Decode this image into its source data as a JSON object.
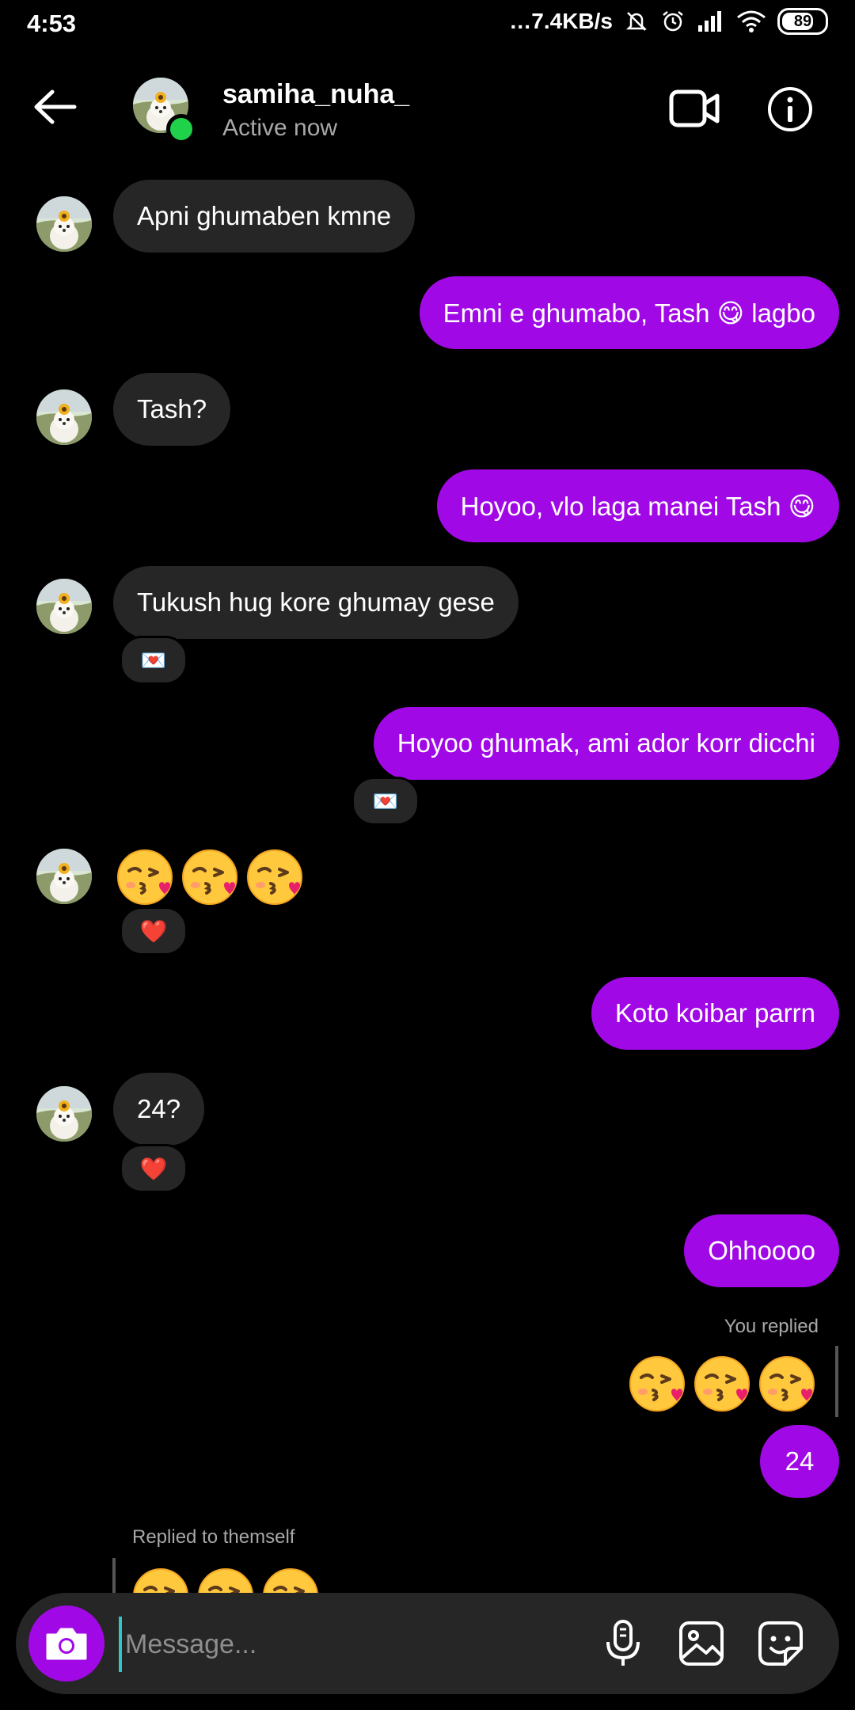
{
  "status_bar": {
    "time": "4:53",
    "net_speed": "…7.4KB/s",
    "battery": "89"
  },
  "header": {
    "username": "samiha_nuha_",
    "status": "Active now"
  },
  "messages": [
    {
      "side": "in",
      "text": "Apni ghumaben kmne"
    },
    {
      "side": "out",
      "text": "Emni e ghumabo, Tash 😋 lagbo"
    },
    {
      "side": "in",
      "text": "Tash?"
    },
    {
      "side": "out",
      "text": "Hoyoo, vlo laga manei Tash 😋"
    },
    {
      "side": "in",
      "text": "Tukush hug kore ghumay gese",
      "reaction": "💌"
    },
    {
      "side": "out",
      "text": "Hoyoo ghumak, ami ador korr dicchi",
      "reaction": "💌"
    },
    {
      "side": "in",
      "emoji": "😘😘😘",
      "reaction": "❤️"
    },
    {
      "side": "out",
      "text": "Koto koibar parrn"
    },
    {
      "side": "in",
      "text": "24?",
      "reaction": "❤️"
    },
    {
      "side": "out",
      "text": "Ohhoooo"
    },
    {
      "side": "out",
      "reply_label": "You replied",
      "emoji": "😘😘😘"
    },
    {
      "side": "out",
      "text": "24"
    },
    {
      "side": "in",
      "reply_label": "Replied to themself",
      "emoji": "😘😘😘"
    }
  ],
  "composer": {
    "placeholder": "Message..."
  },
  "icons": [
    "back-arrow-icon",
    "video-call-icon",
    "info-icon",
    "camera-icon",
    "microphone-icon",
    "gallery-icon",
    "sticker-icon"
  ],
  "colors": {
    "outgoing_bubble": "#a009e6",
    "incoming_bubble": "#262626",
    "online": "#1fd24a"
  }
}
